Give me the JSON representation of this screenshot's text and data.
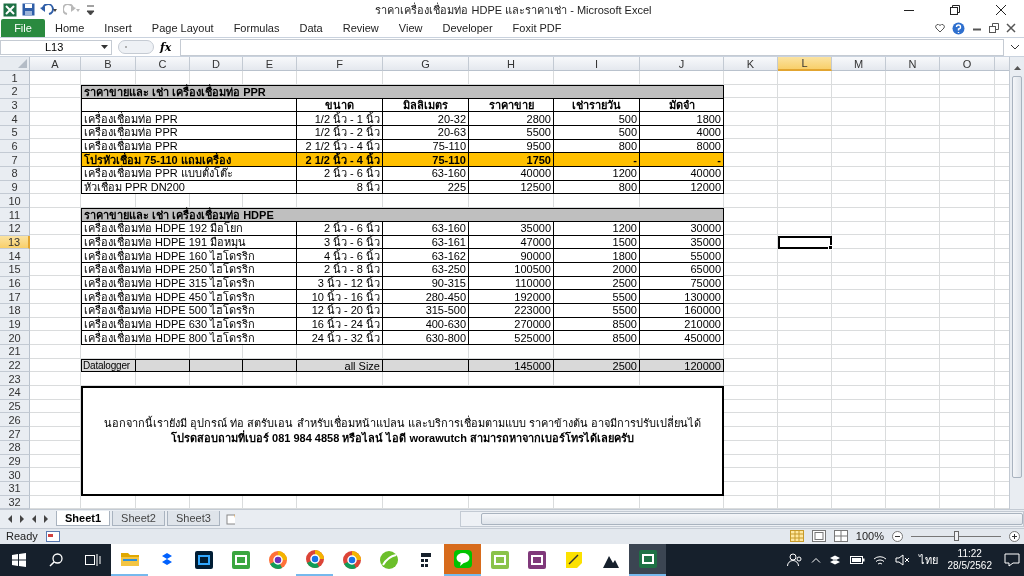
{
  "title_bar": {
    "title": "ราคาเครื่องเชื่อมท่อ HDPE และราคาเช่า  -  Microsoft Excel"
  },
  "ribbon_tabs": [
    {
      "label": "File",
      "kind": "file"
    },
    {
      "label": "Home",
      "kind": "tab"
    },
    {
      "label": "Insert",
      "kind": "tab"
    },
    {
      "label": "Page Layout",
      "kind": "tab"
    },
    {
      "label": "Formulas",
      "kind": "tab"
    },
    {
      "label": "Data",
      "kind": "tab"
    },
    {
      "label": "Review",
      "kind": "tab"
    },
    {
      "label": "View",
      "kind": "tab"
    },
    {
      "label": "Developer",
      "kind": "tab"
    },
    {
      "label": "Foxit PDF",
      "kind": "tab"
    }
  ],
  "formula_bar": {
    "name_box": "L13",
    "function_label": "fx"
  },
  "columns": [
    {
      "label": "A",
      "selected": false
    },
    {
      "label": "B",
      "selected": false
    },
    {
      "label": "C",
      "selected": false
    },
    {
      "label": "D",
      "selected": false
    },
    {
      "label": "E",
      "selected": false
    },
    {
      "label": "F",
      "selected": false
    },
    {
      "label": "G",
      "selected": false
    },
    {
      "label": "H",
      "selected": false
    },
    {
      "label": "I",
      "selected": false
    },
    {
      "label": "J",
      "selected": false
    },
    {
      "label": "K",
      "selected": false
    },
    {
      "label": "L",
      "selected": true
    },
    {
      "label": "M",
      "selected": false
    },
    {
      "label": "N",
      "selected": false
    },
    {
      "label": "O",
      "selected": false
    }
  ],
  "rows": [
    {
      "label": "1",
      "selected": false
    },
    {
      "label": "2",
      "selected": false
    },
    {
      "label": "3",
      "selected": false
    },
    {
      "label": "4",
      "selected": false
    },
    {
      "label": "5",
      "selected": false
    },
    {
      "label": "6",
      "selected": false
    },
    {
      "label": "7",
      "selected": false
    },
    {
      "label": "8",
      "selected": false
    },
    {
      "label": "9",
      "selected": false
    },
    {
      "label": "10",
      "selected": false
    },
    {
      "label": "11",
      "selected": false
    },
    {
      "label": "12",
      "selected": false
    },
    {
      "label": "13",
      "selected": true
    },
    {
      "label": "14",
      "selected": false
    },
    {
      "label": "15",
      "selected": false
    },
    {
      "label": "16",
      "selected": false
    },
    {
      "label": "17",
      "selected": false
    },
    {
      "label": "18",
      "selected": false
    },
    {
      "label": "19",
      "selected": false
    },
    {
      "label": "20",
      "selected": false
    },
    {
      "label": "21",
      "selected": false
    },
    {
      "label": "22",
      "selected": false
    },
    {
      "label": "23",
      "selected": false
    },
    {
      "label": "24",
      "selected": false
    },
    {
      "label": "25",
      "selected": false
    },
    {
      "label": "26",
      "selected": false
    },
    {
      "label": "27",
      "selected": false
    },
    {
      "label": "28",
      "selected": false
    },
    {
      "label": "29",
      "selected": false
    },
    {
      "label": "30",
      "selected": false
    },
    {
      "label": "31",
      "selected": false
    },
    {
      "label": "32",
      "selected": false
    }
  ],
  "price_table": {
    "sections": [
      {
        "title": "ราคาขายและ เช่า เครื่องเชื่อมท่อ PPR",
        "headers": [
          "ขนาด",
          "มิลลิเมตร",
          "ราคาขาย",
          "เช่ารายวัน",
          "มัดจำ"
        ],
        "items": [
          {
            "name": "เครื่องเชื่อมท่อ PPR",
            "size": "1/2 นิ้ว - 1 นิ้ว",
            "millimeters": "20-32",
            "price": "2800",
            "daily_rent": "500",
            "deposit": "1800",
            "highlighted": false
          },
          {
            "name": "เครื่องเชื่อมท่อ PPR",
            "size": "1/2 นิ้ว - 2 นิ้ว",
            "millimeters": "20-63",
            "price": "5500",
            "daily_rent": "500",
            "deposit": "4000",
            "highlighted": false
          },
          {
            "name": "เครื่องเชื่อมท่อ PPR",
            "size": "2 1/2 นิ้ว - 4 นิ้ว",
            "millimeters": "75-110",
            "price": "9500",
            "daily_rent": "800",
            "deposit": "8000",
            "highlighted": false
          },
          {
            "name": "โปรหัวเชื่อม 75-110 แถมเครื่อง",
            "size": "2 1/2 นิ้ว - 4 นิ้ว",
            "millimeters": "75-110",
            "price": "1750",
            "daily_rent": "-",
            "deposit": "-",
            "highlighted": true
          },
          {
            "name": "เครื่องเชื่อมท่อ PPR แบบตั้งโต๊ะ",
            "size": "2 นิ้ว - 6 นิ้ว",
            "millimeters": "63-160",
            "price": "40000",
            "daily_rent": "1200",
            "deposit": "40000",
            "highlighted": false
          },
          {
            "name": "หัวเชื่อม PPR DN200",
            "size": "8 นิ้ว",
            "millimeters": "225",
            "price": "12500",
            "daily_rent": "800",
            "deposit": "12000",
            "highlighted": false
          }
        ]
      },
      {
        "title": "ราคาขายและ เช่า เครื่องเชื่อมท่อ HDPE",
        "items": [
          {
            "name": "เครื่องเชื่อมท่อ HDPE 192 มือโยก",
            "size": "2 นิ้ว - 6 นิ้ว",
            "millimeters": "63-160",
            "price": "35000",
            "daily_rent": "1200",
            "deposit": "30000",
            "highlighted": false
          },
          {
            "name": "เครื่องเชื่อมท่อ HDPE 191 มือหมุน",
            "size": "3 นิ้ว - 6 นิ้ว",
            "millimeters": "63-161",
            "price": "47000",
            "daily_rent": "1500",
            "deposit": "35000",
            "highlighted": false
          },
          {
            "name": "เครื่องเชื่อมท่อ HDPE 160 ไฮโดรริก",
            "size": "4 นิ้ว - 6 นิ้ว",
            "millimeters": "63-162",
            "price": "90000",
            "daily_rent": "1800",
            "deposit": "55000",
            "highlighted": false
          },
          {
            "name": "เครื่องเชื่อมท่อ HDPE 250 ไฮโดรริก",
            "size": "2 นิ้ว - 8 นิ้ว",
            "millimeters": "63-250",
            "price": "100500",
            "daily_rent": "2000",
            "deposit": "65000",
            "highlighted": false
          },
          {
            "name": "เครื่องเชื่อมท่อ HDPE 315 ไฮโดรริก",
            "size": "3 นิ้ว - 12 นิ้ว",
            "millimeters": "90-315",
            "price": "110000",
            "daily_rent": "2500",
            "deposit": "75000",
            "highlighted": false
          },
          {
            "name": "เครื่องเชื่อมท่อ HDPE 450 ไฮโดรริก",
            "size": "10 นิ้ว - 16 นิ้ว",
            "millimeters": "280-450",
            "price": "192000",
            "daily_rent": "5500",
            "deposit": "130000",
            "highlighted": false
          },
          {
            "name": "เครื่องเชื่อมท่อ HDPE 500 ไฮโดรริก",
            "size": "12 นิ้ว - 20 นิ้ว",
            "millimeters": "315-500",
            "price": "223000",
            "daily_rent": "5500",
            "deposit": "160000",
            "highlighted": false
          },
          {
            "name": "เครื่องเชื่อมท่อ HDPE 630 ไฮโดรริก",
            "size": "16 นิ้ว - 24 นิ้ว",
            "millimeters": "400-630",
            "price": "270000",
            "daily_rent": "8500",
            "deposit": "210000",
            "highlighted": false
          },
          {
            "name": "เครื่องเชื่อมท่อ HDPE 800 ไฮโดรริก",
            "size": "24 นิ้ว - 32 นิ้ว",
            "millimeters": "630-800",
            "price": "525000",
            "daily_rent": "8500",
            "deposit": "450000",
            "highlighted": false
          }
        ]
      }
    ],
    "total_row": {
      "name": "Datalogger",
      "size": "all Size",
      "price": "145000",
      "daily_rent": "2500",
      "deposit": "120000"
    }
  },
  "note": {
    "line_1": "นอกจากนี้เรายังมี อุปกรณ์ ท่อ สตรับเอน สำหรับเชื่อมหน้าแปลน และบริการเชื่อมตามแบบ ราคาข้างต้น อาจมีการปรับเปลี่ยนได้",
    "line_2": "โปรดสอบถามที่เบอร์ 081 984 4858 หรือไลน์ ไอดี worawutch สามารถหาจากเบอร์โทรได้เลยครับ"
  },
  "sheet_tabs": [
    {
      "label": "Sheet1",
      "selected": true
    },
    {
      "label": "Sheet2",
      "selected": false
    },
    {
      "label": "Sheet3",
      "selected": false
    }
  ],
  "status_bar": {
    "mode": "Ready",
    "zoom": "100%",
    "zoom_slider": {
      "level": 0.5
    }
  },
  "taskbar": {
    "apps": [
      {
        "kind": "folder",
        "running": true,
        "flashing": false,
        "focused": false
      },
      {
        "kind": "box",
        "running": false,
        "flashing": false,
        "focused": false
      },
      {
        "kind": "tile_blue",
        "running": false,
        "flashing": false,
        "focused": false
      },
      {
        "kind": "tile_green",
        "running": false,
        "flashing": false,
        "focused": false
      },
      {
        "kind": "browser_orange",
        "running": false,
        "flashing": false,
        "focused": false
      },
      {
        "kind": "browser_multi",
        "running": true,
        "flashing": false,
        "focused": false
      },
      {
        "kind": "browser_multi",
        "running": false,
        "flashing": false,
        "focused": false
      },
      {
        "kind": "ball",
        "running": false,
        "flashing": false,
        "focused": false
      },
      {
        "kind": "calculator",
        "running": false,
        "flashing": false,
        "focused": false
      },
      {
        "kind": "chat",
        "running": true,
        "flashing": true,
        "focused": false
      },
      {
        "kind": "notepad",
        "running": false,
        "flashing": false,
        "focused": false
      },
      {
        "kind": "tile_purple",
        "running": false,
        "flashing": false,
        "focused": false
      },
      {
        "kind": "sticky",
        "running": false,
        "flashing": false,
        "focused": false
      },
      {
        "kind": "image",
        "running": false,
        "flashing": false,
        "focused": false
      },
      {
        "kind": "spreadsheet",
        "running": true,
        "flashing": false,
        "focused": true
      }
    ],
    "language": "ไทย",
    "time": "11:22",
    "date": "28/5/2562"
  }
}
